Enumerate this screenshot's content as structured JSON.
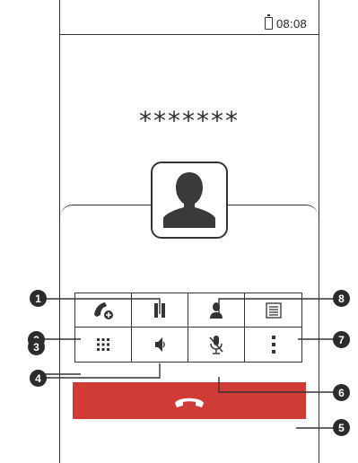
{
  "status_bar": {
    "time": "08:08",
    "battery_icon": "battery-icon"
  },
  "caller": {
    "number": "*******",
    "avatar_icon": "contact-silhouette-icon"
  },
  "controls": [
    {
      "id": "add-call",
      "icon": "add-call-icon"
    },
    {
      "id": "hold",
      "icon": "pause-icon"
    },
    {
      "id": "contacts",
      "icon": "contact-icon"
    },
    {
      "id": "notes",
      "icon": "notes-icon"
    },
    {
      "id": "dialpad",
      "icon": "dialpad-icon"
    },
    {
      "id": "speaker",
      "icon": "speaker-icon"
    },
    {
      "id": "mute",
      "icon": "mute-microphone-icon"
    },
    {
      "id": "more",
      "icon": "more-vertical-icon"
    }
  ],
  "end_call": {
    "icon": "end-call-icon",
    "color": "#d03c35"
  },
  "callouts": [
    "1",
    "2",
    "3",
    "4",
    "5",
    "6",
    "7",
    "8"
  ]
}
